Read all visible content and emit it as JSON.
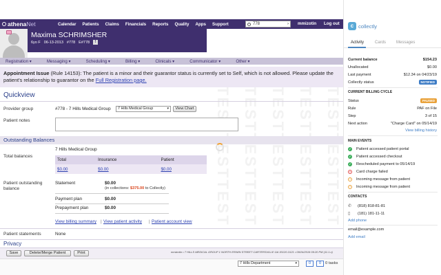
{
  "nav": {
    "logo_bold": "athena",
    "logo_lite": "Net",
    "items": [
      "Calendar",
      "Patients",
      "Claims",
      "Financials",
      "Reports",
      "Quality",
      "Apps",
      "Support"
    ],
    "search_value": "778",
    "user": "mmizotin",
    "logout": "Log out"
  },
  "patient": {
    "name": "Maxima SCHRIMSHER",
    "age_sex": "6yo F",
    "dob": "06-13-2013",
    "id": "#778",
    "enterprise_id": "E#778",
    "flag": "!"
  },
  "secnav": {
    "items": [
      "Registration ▾",
      "Messaging ▾",
      "Scheduling ▾",
      "Billing ▾",
      "Clinicals ▾",
      "Communicator ▾",
      "Other ▾"
    ]
  },
  "alert": {
    "title": "Appointment Issue",
    "rule": "(Rule 14153):",
    "text": "The patient is a minor and their guarantor status is currently set to Self, which is not allowed. Please update the patient's relationship to guarantor on the",
    "link": "Full Registration page."
  },
  "watermark": "TESTTESTTEST",
  "quickview": {
    "title": "Quickview",
    "provider_label": "Provider group",
    "provider_value": "#778 - 7 Hills Medical Group",
    "provider_select": "7 Hills Medical Group",
    "view_chart": "View Chart",
    "notes_label": "Patient notes"
  },
  "balances": {
    "title": "Outstanding Balances",
    "total_label": "Total balances",
    "group": "7 Hills Medical Group",
    "headers": [
      "Total",
      "Insurance",
      "Patient"
    ],
    "values": [
      "$0.00",
      "$0.00",
      "$0.00"
    ],
    "patient_outstanding_label": "Patient outstanding balance",
    "statement_label": "Statement",
    "statement_value": "$0.00",
    "collections_prefix": "(in collections:",
    "collections_amount": "$375.00",
    "collections_suffix": "to Collectly)",
    "payment_plan_label": "Payment plan",
    "payment_plan_value": "$0.00",
    "prepayment_label": "Prepayment plan",
    "prepayment_value": "$0.00",
    "link_billing": "View billing summary",
    "link_activity": "View patient activity",
    "link_account": "Patient account view",
    "sep": "|",
    "statements_label": "Patient statements",
    "statements_value": "None",
    "privacy": "Privacy"
  },
  "footer": {
    "save": "Save",
    "delete_merge": "Delete/Merge Patient",
    "print": "Print",
    "address": "mmizotin • 7 HILLS MEDICAL GROUP 1 NORTH ERWIN STREET CARTERSVILLE GA 30120-3121 • 09/24/2019 09:20 PM (11.1.x)",
    "department": "7 Hills Department",
    "count_a": "0",
    "count_b": "0",
    "tasks": "0 tasks"
  },
  "collectly": {
    "brand": "collectly",
    "tabs": [
      "Activity",
      "Cards",
      "Messages"
    ],
    "current_balance_label": "Current balance",
    "current_balance": "$154.23",
    "unallocated_label": "Unallocated",
    "unallocated": "$0.00",
    "last_payment_label": "Last payment",
    "last_payment": "$12.34 on 04/23/19",
    "status_label": "Collectly status",
    "status": "NOTIFIED",
    "cycle_title": "CURRENT BILLING CYCLE",
    "cycle_status_label": "Status",
    "cycle_status": "PAUSED",
    "rule_label": "Rule",
    "rule": "PAF on File",
    "step_label": "Step",
    "step": "3 of 15",
    "next_label": "Next action",
    "next": "\"Charge Card\" on 05/14/19",
    "history_link": "View billing history",
    "events_title": "MAIN EVENTS",
    "events": [
      {
        "text": "Patient accessed patient portal",
        "kind": "ok"
      },
      {
        "text": "Patient accessed checkout",
        "kind": "ok"
      },
      {
        "text": "Rescheduled payment to 05/14/19",
        "kind": "ok"
      },
      {
        "text": "Card charge failed",
        "kind": "fail"
      },
      {
        "text": "Incoming message from patient",
        "kind": "msg"
      },
      {
        "text": "Incoming message from patient",
        "kind": "msg"
      }
    ],
    "contacts_title": "CONTACTS",
    "phone1": "(818) 818-81-81",
    "phone2": "(181) 181-11-11",
    "add_phone": "Add phone",
    "email": "email@example.com",
    "add_email": "Add email",
    "colors": {
      "notified": "#3d7cc5",
      "paused": "#e9a23b",
      "ok": "#3cae5b",
      "fail": "#e04a4a"
    }
  }
}
